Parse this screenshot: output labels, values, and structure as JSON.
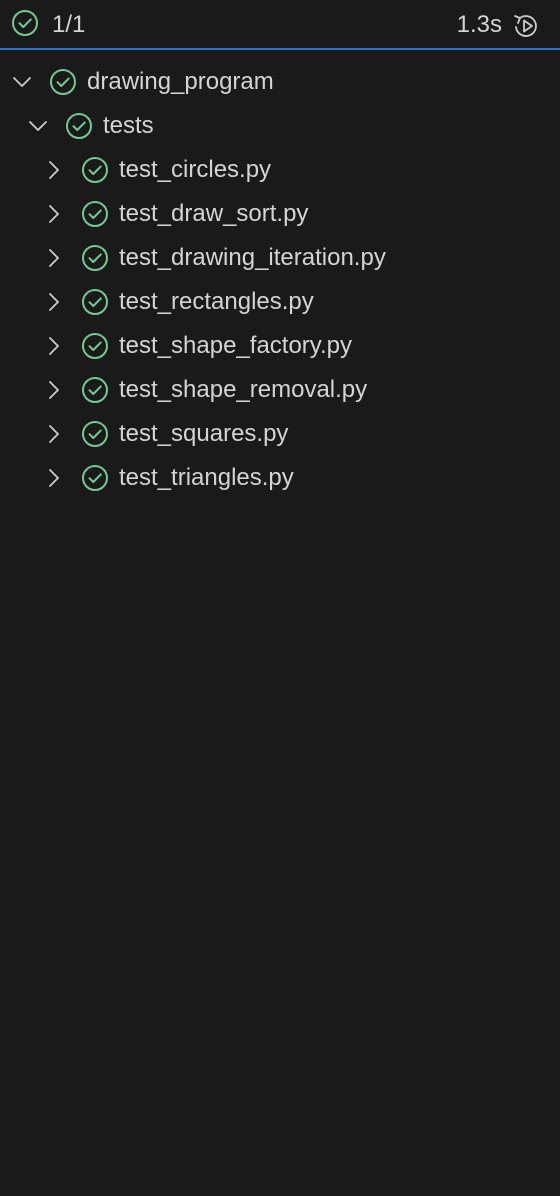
{
  "header": {
    "status_icon": "check-circle-icon",
    "summary": "1/1",
    "duration": "1.3s",
    "rerun_icon": "rerun-icon"
  },
  "colors": {
    "background": "#1a1a1a",
    "pass_green": "#73c991",
    "divider_blue": "#2b73c2",
    "text": "#d4d4d4"
  },
  "tree": {
    "root": {
      "label": "drawing_program",
      "expanded": true,
      "status": "passed"
    },
    "folder": {
      "label": "tests",
      "expanded": true,
      "status": "passed"
    },
    "files": [
      {
        "label": "test_circles.py",
        "expanded": false,
        "status": "passed"
      },
      {
        "label": "test_draw_sort.py",
        "expanded": false,
        "status": "passed"
      },
      {
        "label": "test_drawing_iteration.py",
        "expanded": false,
        "status": "passed"
      },
      {
        "label": "test_rectangles.py",
        "expanded": false,
        "status": "passed"
      },
      {
        "label": "test_shape_factory.py",
        "expanded": false,
        "status": "passed"
      },
      {
        "label": "test_shape_removal.py",
        "expanded": false,
        "status": "passed"
      },
      {
        "label": "test_squares.py",
        "expanded": false,
        "status": "passed"
      },
      {
        "label": "test_triangles.py",
        "expanded": false,
        "status": "passed"
      }
    ]
  }
}
